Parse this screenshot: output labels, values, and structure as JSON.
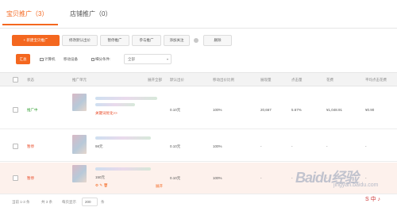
{
  "tabs": [
    {
      "label": "宝贝推广（3）",
      "active": true
    },
    {
      "label": "店铺推广（0）",
      "active": false
    }
  ],
  "toolbar": {
    "new_promo": "+ 新建宝贝推广",
    "modify_bid": "修改默认出价",
    "pause": "暂停推广",
    "join": "参与推广",
    "add_attention": "添加关注",
    "delete": "删除"
  },
  "filters": {
    "summary": "汇总",
    "computer": "计算机",
    "mobile": "移动设备",
    "segment_label": "细分条件:",
    "segment_value": "全部"
  },
  "table": {
    "headers": {
      "status": "状态",
      "unit": "推广单元",
      "expand_all": "展开全部",
      "default_bid": "默认出价",
      "mobile_bid_ratio": "移动出价比例",
      "impressions": "展现量",
      "clicks": "点击量",
      "ctr": "点击率",
      "cost": "花费",
      "avg_cpc": "平均点击花费"
    },
    "rows": [
      {
        "status": "推广中",
        "status_color": "#3aa33a",
        "sub": "关键词优化>>",
        "bid": "0.10元",
        "ratio": "100%",
        "impressions": "20,667",
        "clicks": "-",
        "ctr": "5.67%",
        "cost": "¥1,048.91",
        "cpc": "¥0.90"
      },
      {
        "status": "暂停",
        "status_color": "#e8431f",
        "sub": "98元",
        "bid": "0.10元",
        "ratio": "100%",
        "impressions": "-",
        "clicks": "-",
        "ctr": "-",
        "cost": "-",
        "cpc": "-"
      },
      {
        "status": "暂停",
        "status_color": "#e8431f",
        "sub": "150元",
        "bid": "0.10元",
        "ratio": "100%",
        "impressions": "-",
        "clicks": "-",
        "ctr": "-",
        "cost": "-",
        "cpc": "-",
        "expand": "展开"
      }
    ]
  },
  "footer": {
    "records": "当前 1-3 条",
    "total": "共 3 条",
    "per_page_label": "每页显示",
    "per_page_value": "200",
    "per_page_unit": "条"
  },
  "watermark": {
    "text": "Baidu经验",
    "sub": "jingyan.baidu.com"
  },
  "colors": {
    "accent": "#f4671f",
    "status_active": "#3aa33a",
    "status_paused": "#e8431f"
  }
}
